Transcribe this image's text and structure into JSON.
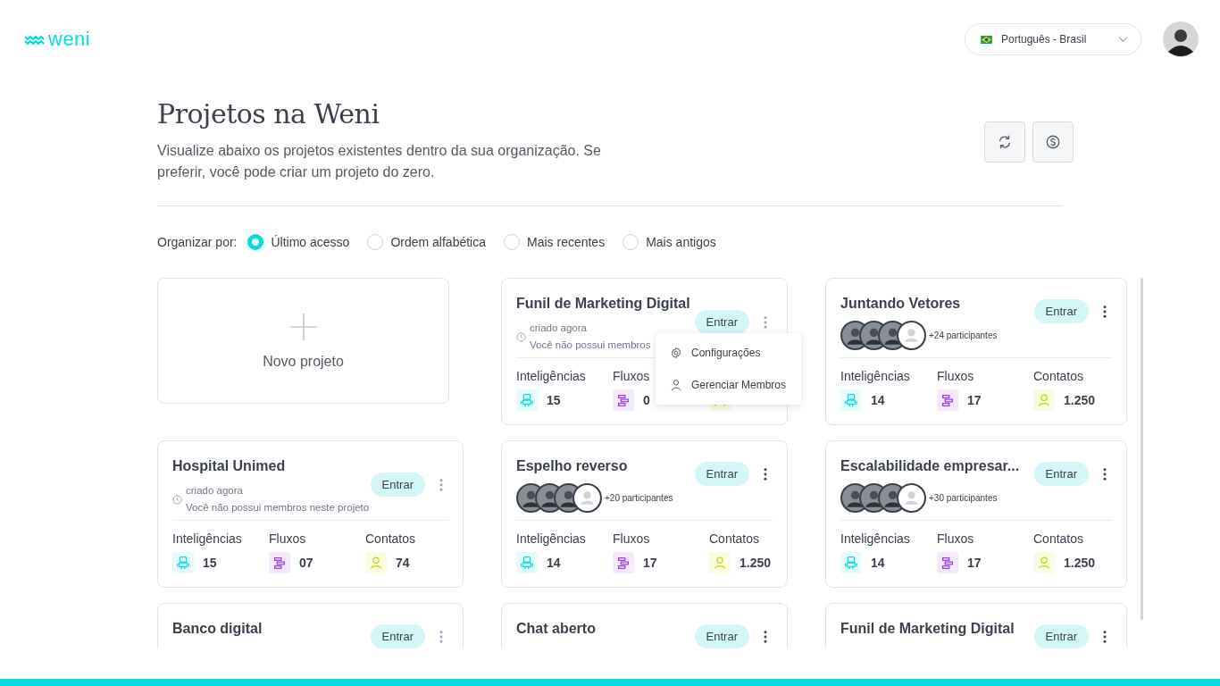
{
  "header": {
    "logo": "weni",
    "language": "Português - Brasil"
  },
  "page": {
    "title": "Projetos na Weni",
    "description": "Visualize abaixo os projetos existentes dentro da sua organização. Se preferir, você pode criar um projeto do zero.",
    "actions": [
      {
        "kind": "refresh"
      },
      {
        "kind": "billing"
      }
    ]
  },
  "sort": {
    "label": "Organizar por:",
    "options": [
      {
        "label": "Último acesso",
        "selected": true
      },
      {
        "label": "Ordem alfabética",
        "selected": false
      },
      {
        "label": "Mais recentes",
        "selected": false
      },
      {
        "label": "Mais antigos",
        "selected": false
      }
    ]
  },
  "new_project": {
    "label": "Novo projeto"
  },
  "cards": [
    {
      "kind": "no-members",
      "title": "Funil de Marketing Digital",
      "created": "criado agora",
      "note": "Você não possui membros",
      "button": "Entrar",
      "menu": [
        {
          "kind": "settings",
          "label": "Configurações"
        },
        {
          "kind": "members",
          "label": "Gerenciar Membros"
        }
      ],
      "stats": [
        {
          "kind": "bots",
          "label": "Inteligências",
          "value": "15"
        },
        {
          "kind": "flows",
          "label": "Fluxos",
          "value": "0"
        },
        {
          "kind": "contacts"
        }
      ]
    },
    {
      "kind": "members",
      "title": "Juntando Vetores",
      "participants": "+24 participantes",
      "button": "Entrar",
      "stats": [
        {
          "kind": "bots",
          "label": "Inteligências",
          "value": "14"
        },
        {
          "kind": "flows",
          "label": "Fluxos",
          "value": "17"
        },
        {
          "kind": "contacts",
          "label": "Contatos",
          "value": "1.250"
        }
      ]
    },
    {
      "kind": "no-members",
      "title": "Hospital Unimed",
      "created": "criado agora",
      "note": "Você não possui membros neste projeto",
      "button": "Entrar",
      "stats": [
        {
          "kind": "bots",
          "label": "Inteligências",
          "value": "15"
        },
        {
          "kind": "flows",
          "label": "Fluxos",
          "value": "07"
        },
        {
          "kind": "contacts",
          "label": "Contatos",
          "value": "74"
        }
      ]
    },
    {
      "kind": "members",
      "title": "Espelho reverso",
      "participants": "+20 participantes",
      "button": "Entrar",
      "stats": [
        {
          "kind": "bots",
          "label": "Inteligências",
          "value": "14"
        },
        {
          "kind": "flows",
          "label": "Fluxos",
          "value": "17"
        },
        {
          "kind": "contacts",
          "label": "Contatos",
          "value": "1.250"
        }
      ]
    },
    {
      "kind": "members",
      "title": "Escalabilidade empresar...",
      "participants": "+30 participantes",
      "button": "Entrar",
      "stats": [
        {
          "kind": "bots",
          "label": "Inteligências",
          "value": "14"
        },
        {
          "kind": "flows",
          "label": "Fluxos",
          "value": "17"
        },
        {
          "kind": "contacts",
          "label": "Contatos",
          "value": "1.250"
        }
      ]
    },
    {
      "kind": "no-members",
      "title": "Banco digital",
      "button": "Entrar"
    },
    {
      "kind": "members",
      "title": "Chat aberto",
      "button": "Entrar"
    },
    {
      "kind": "members",
      "title": "Funil de Marketing Digital",
      "button": "Entrar"
    }
  ]
}
